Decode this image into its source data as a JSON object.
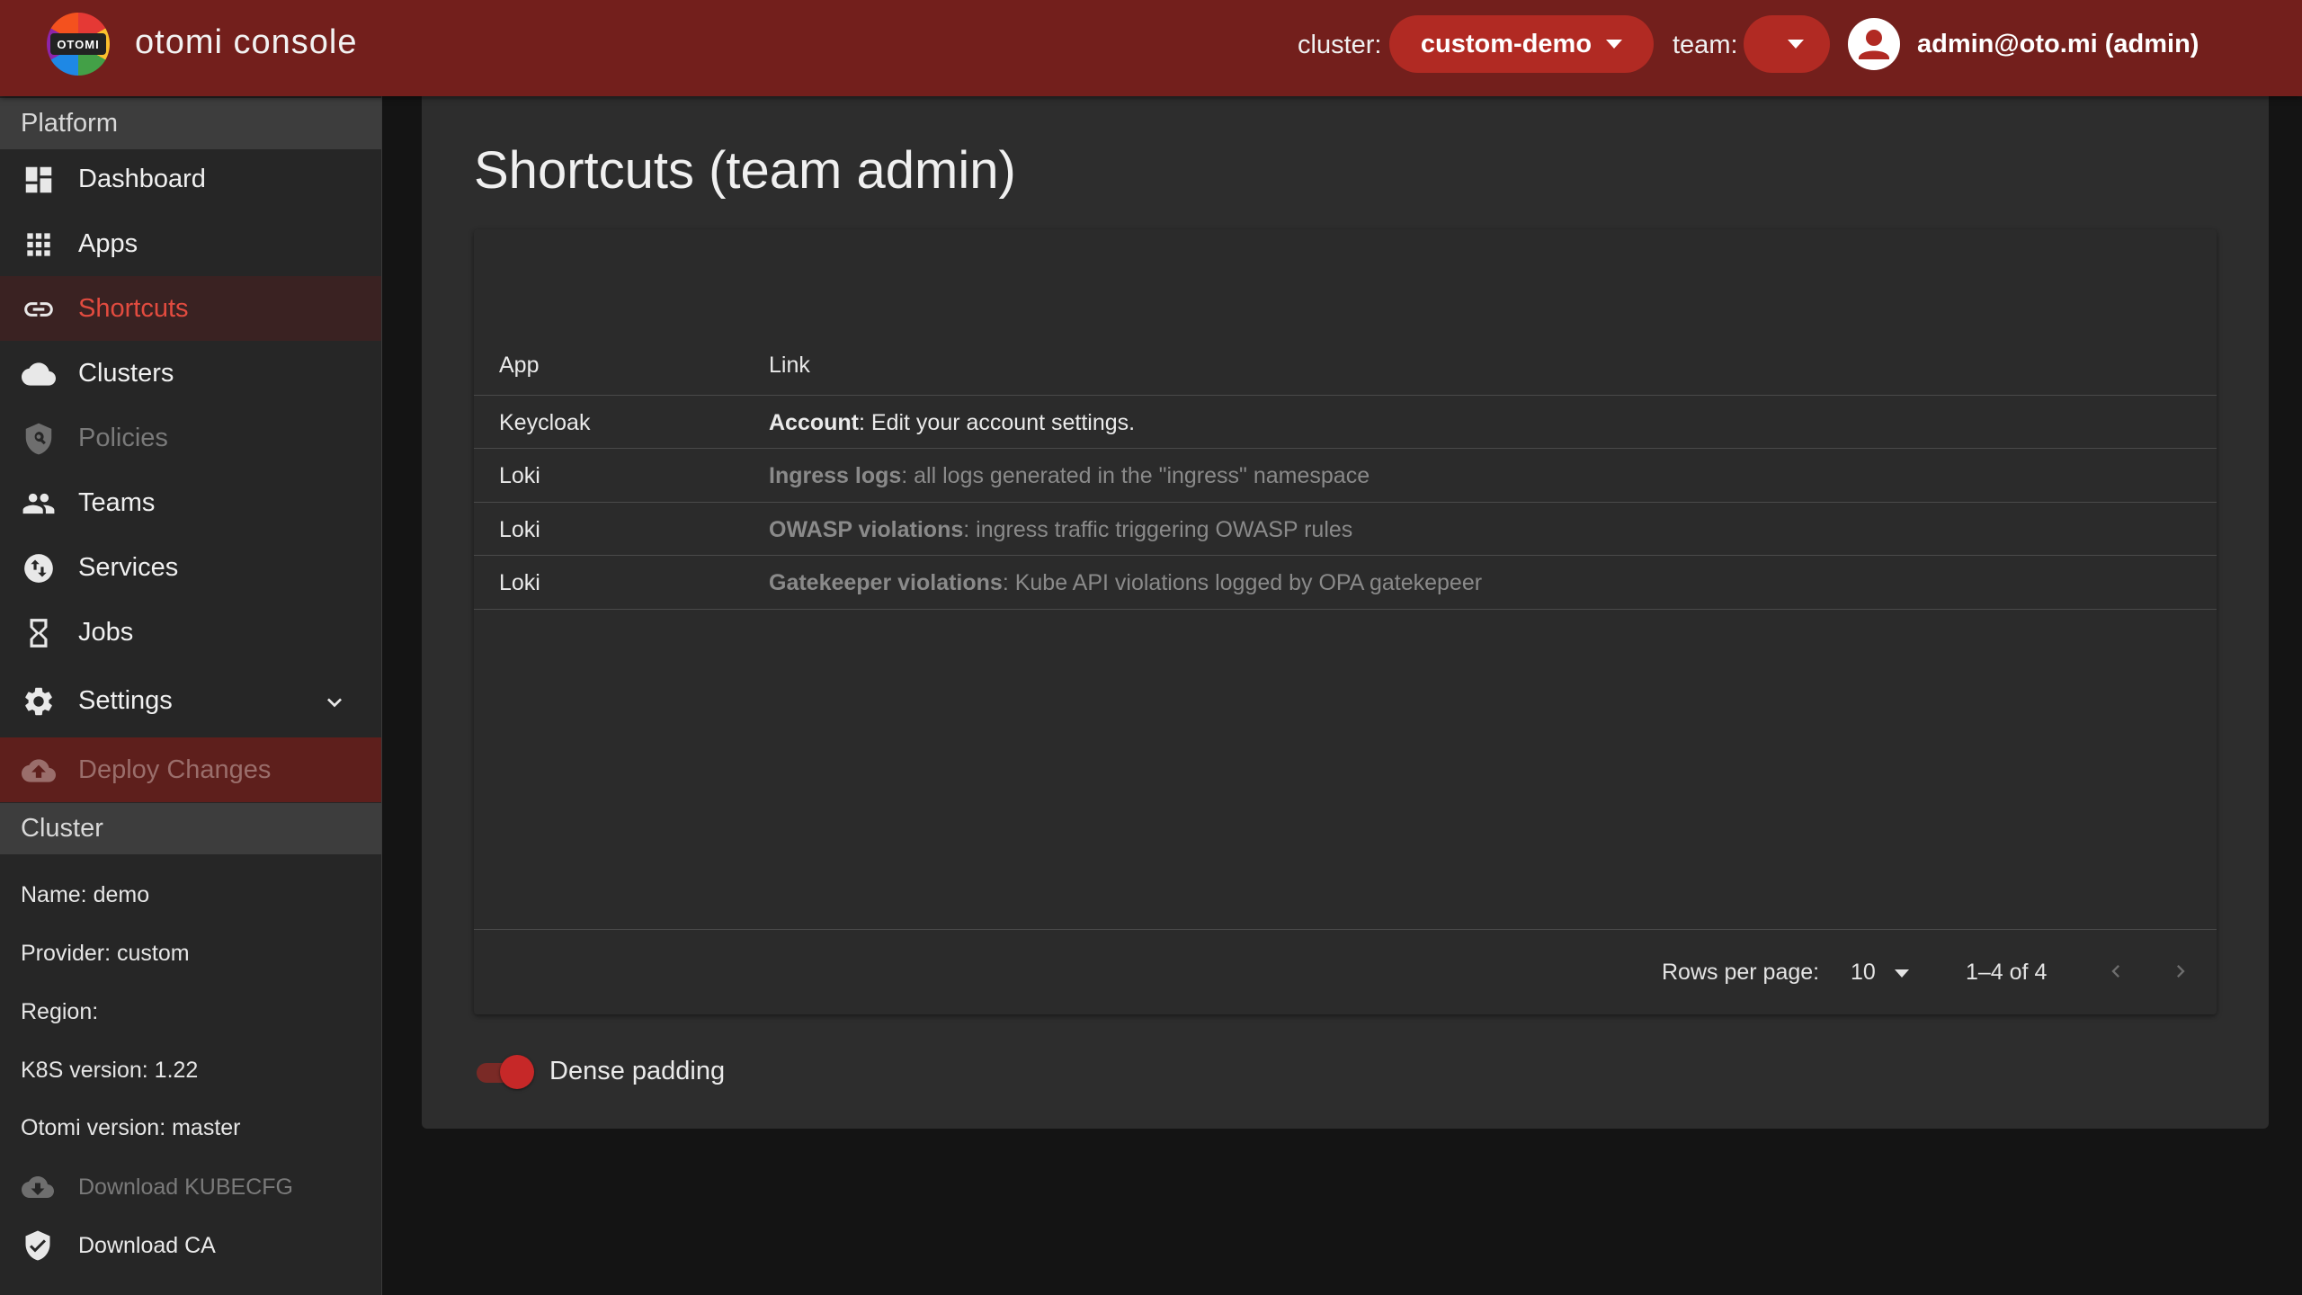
{
  "header": {
    "logo_text": "OTOMI",
    "app_title": "otomi console",
    "cluster_label": "cluster:",
    "cluster_value": "custom-demo",
    "team_label": "team:",
    "team_value": "",
    "user": "admin@oto.mi (admin)",
    "accent_color": "#731f1c",
    "pill_color": "#b12a23"
  },
  "sidebar": {
    "platform_heading": "Platform",
    "items": [
      {
        "label": "Dashboard",
        "icon": "dashboard-icon"
      },
      {
        "label": "Apps",
        "icon": "apps-grid-icon"
      },
      {
        "label": "Shortcuts",
        "icon": "link-icon",
        "active": true
      },
      {
        "label": "Clusters",
        "icon": "cloud-icon"
      },
      {
        "label": "Policies",
        "icon": "policy-shield-icon",
        "disabled": true
      },
      {
        "label": "Teams",
        "icon": "people-icon"
      },
      {
        "label": "Services",
        "icon": "swap-circle-icon"
      },
      {
        "label": "Jobs",
        "icon": "hourglass-icon"
      },
      {
        "label": "Settings",
        "icon": "gear-icon"
      },
      {
        "label": "Deploy Changes",
        "icon": "cloud-upload-icon",
        "disabled": true
      }
    ],
    "cluster_heading": "Cluster",
    "cluster_info": {
      "name": "Name: demo",
      "provider": "Provider: custom",
      "region": "Region:",
      "k8s": "K8S version: 1.22",
      "otomi": "Otomi version: master"
    },
    "download_kubecfg": "Download KUBECFG",
    "download_ca": "Download CA"
  },
  "main": {
    "title": "Shortcuts (team admin)",
    "columns": [
      "App",
      "Link"
    ],
    "rows": [
      {
        "app": "Keycloak",
        "link_title": "Account",
        "link_desc": ": Edit your account settings.",
        "enabled": true
      },
      {
        "app": "Loki",
        "link_title": "Ingress logs",
        "link_desc": ": all logs generated in the \"ingress\" namespace",
        "enabled": false
      },
      {
        "app": "Loki",
        "link_title": "OWASP violations",
        "link_desc": ": ingress traffic triggering OWASP rules",
        "enabled": false
      },
      {
        "app": "Loki",
        "link_title": "Gatekeeper violations",
        "link_desc": ": Kube API violations logged by OPA gatekepeer",
        "enabled": false
      }
    ],
    "rows_per_page_label": "Rows per page:",
    "rows_per_page_value": "10",
    "page_range": "1–4 of 4",
    "dense_padding_label": "Dense padding",
    "dense_padding_on": true
  }
}
